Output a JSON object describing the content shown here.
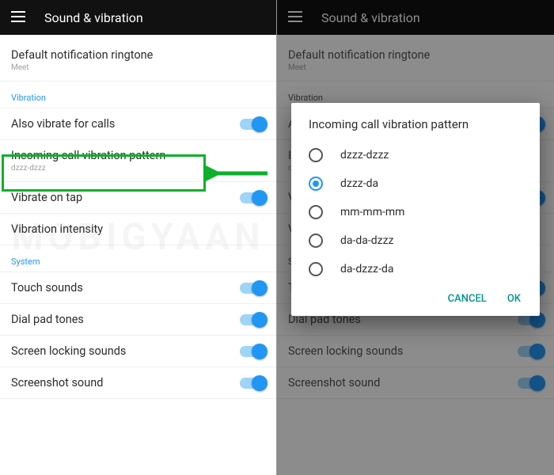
{
  "appbar": {
    "title": "Sound & vibration"
  },
  "left": {
    "top": {
      "title": "Default notification ringtone",
      "subtitle": "Meet"
    },
    "section_vibration": "Vibration",
    "vibrate_calls": "Also vibrate for calls",
    "incoming_pattern": {
      "title": "Incoming call vibration pattern",
      "subtitle": "dzzz-dzzz"
    },
    "vibrate_tap": "Vibrate on tap",
    "vibration_intensity": "Vibration intensity",
    "section_system": "System",
    "touch_sounds": "Touch sounds",
    "dial_pad": "Dial pad tones",
    "lock_sounds": "Screen locking sounds",
    "screenshot_sound": "Screenshot sound"
  },
  "dialog": {
    "title": "Incoming call vibration pattern",
    "options": {
      "o0": "dzzz-dzzz",
      "o1": "dzzz-da",
      "o2": "mm-mm-mm",
      "o3": "da-da-dzzz",
      "o4": "da-dzzz-da"
    },
    "selected_index": 1,
    "cancel": "CANCEL",
    "ok": "OK"
  },
  "watermark": "MOBIGYAAN"
}
